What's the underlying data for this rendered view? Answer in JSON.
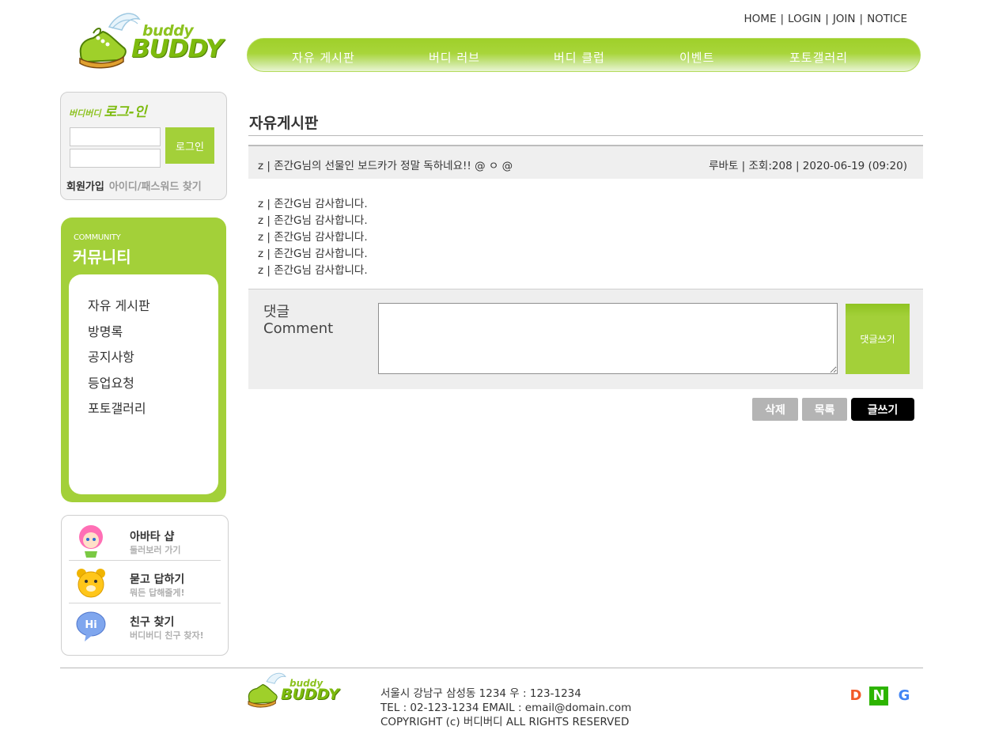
{
  "brand": {
    "logo_small": "buddy",
    "logo_big": "BUDDY"
  },
  "top_links": [
    "HOME",
    "LOGIN",
    "JOIN",
    "NOTICE"
  ],
  "gnb": [
    "자유 게시판",
    "버디 러브",
    "버디 클럽",
    "이벤트",
    "포토갤러리"
  ],
  "login": {
    "title_small": "버디버디",
    "title_big": "로그-인",
    "id_value": "",
    "pw_value": "",
    "button": "로그인",
    "join": "회원가입",
    "find": "아이디/패스워드 찾기"
  },
  "community": {
    "title_en": "COMMUNITY",
    "title_ko": "커뮤니티",
    "items": [
      "자유 게시판",
      "방명록",
      "공지사항",
      "등업요청",
      "포토갤러리"
    ]
  },
  "quick": [
    {
      "title": "아바타 샵",
      "sub": "둘러보러 가기",
      "icon": "avatar-icon"
    },
    {
      "title": "묻고 답하기",
      "sub": "뭐든 답해줄게!",
      "icon": "bear-icon"
    },
    {
      "title": "친구 찾기",
      "sub": "버디버디 친구 찾자!",
      "icon": "hi-bubble-icon"
    }
  ],
  "page_title": "자유게시판",
  "post": {
    "subject": "z | 존간G님의 선물인 보드카가 정말 독하네요!! @ ㅇ @",
    "meta": "루바토 | 조회:208 | 2020-06-19 (09:20)",
    "lines": [
      "z | 존간G님 감사합니다.",
      "z | 존간G님 감사합니다.",
      "z | 존간G님 감사합니다.",
      "z | 존간G님 감사합니다.",
      "z | 존간G님 감사합니다."
    ]
  },
  "comment": {
    "label_ko": "댓글",
    "label_en": "Comment",
    "value": "",
    "button": "댓글쓰기"
  },
  "actions": {
    "delete": "삭제",
    "list": "목록",
    "write": "글쓰기"
  },
  "footer": {
    "address": "서울시 강남구 삼성동 1234 우 : 123-1234",
    "contact": "TEL : 02-123-1234 EMAIL : email@domain.com",
    "copyright": "COPYRIGHT (c) 버디버디 ALL RIGHTS RESERVED",
    "sns": [
      "D",
      "N",
      "G"
    ]
  },
  "colors": {
    "accent": "#a3d039",
    "accent_dark": "#7dbb0e",
    "text": "#333333",
    "button_dark": "#000000",
    "button_gray": "#b4b4b4"
  }
}
